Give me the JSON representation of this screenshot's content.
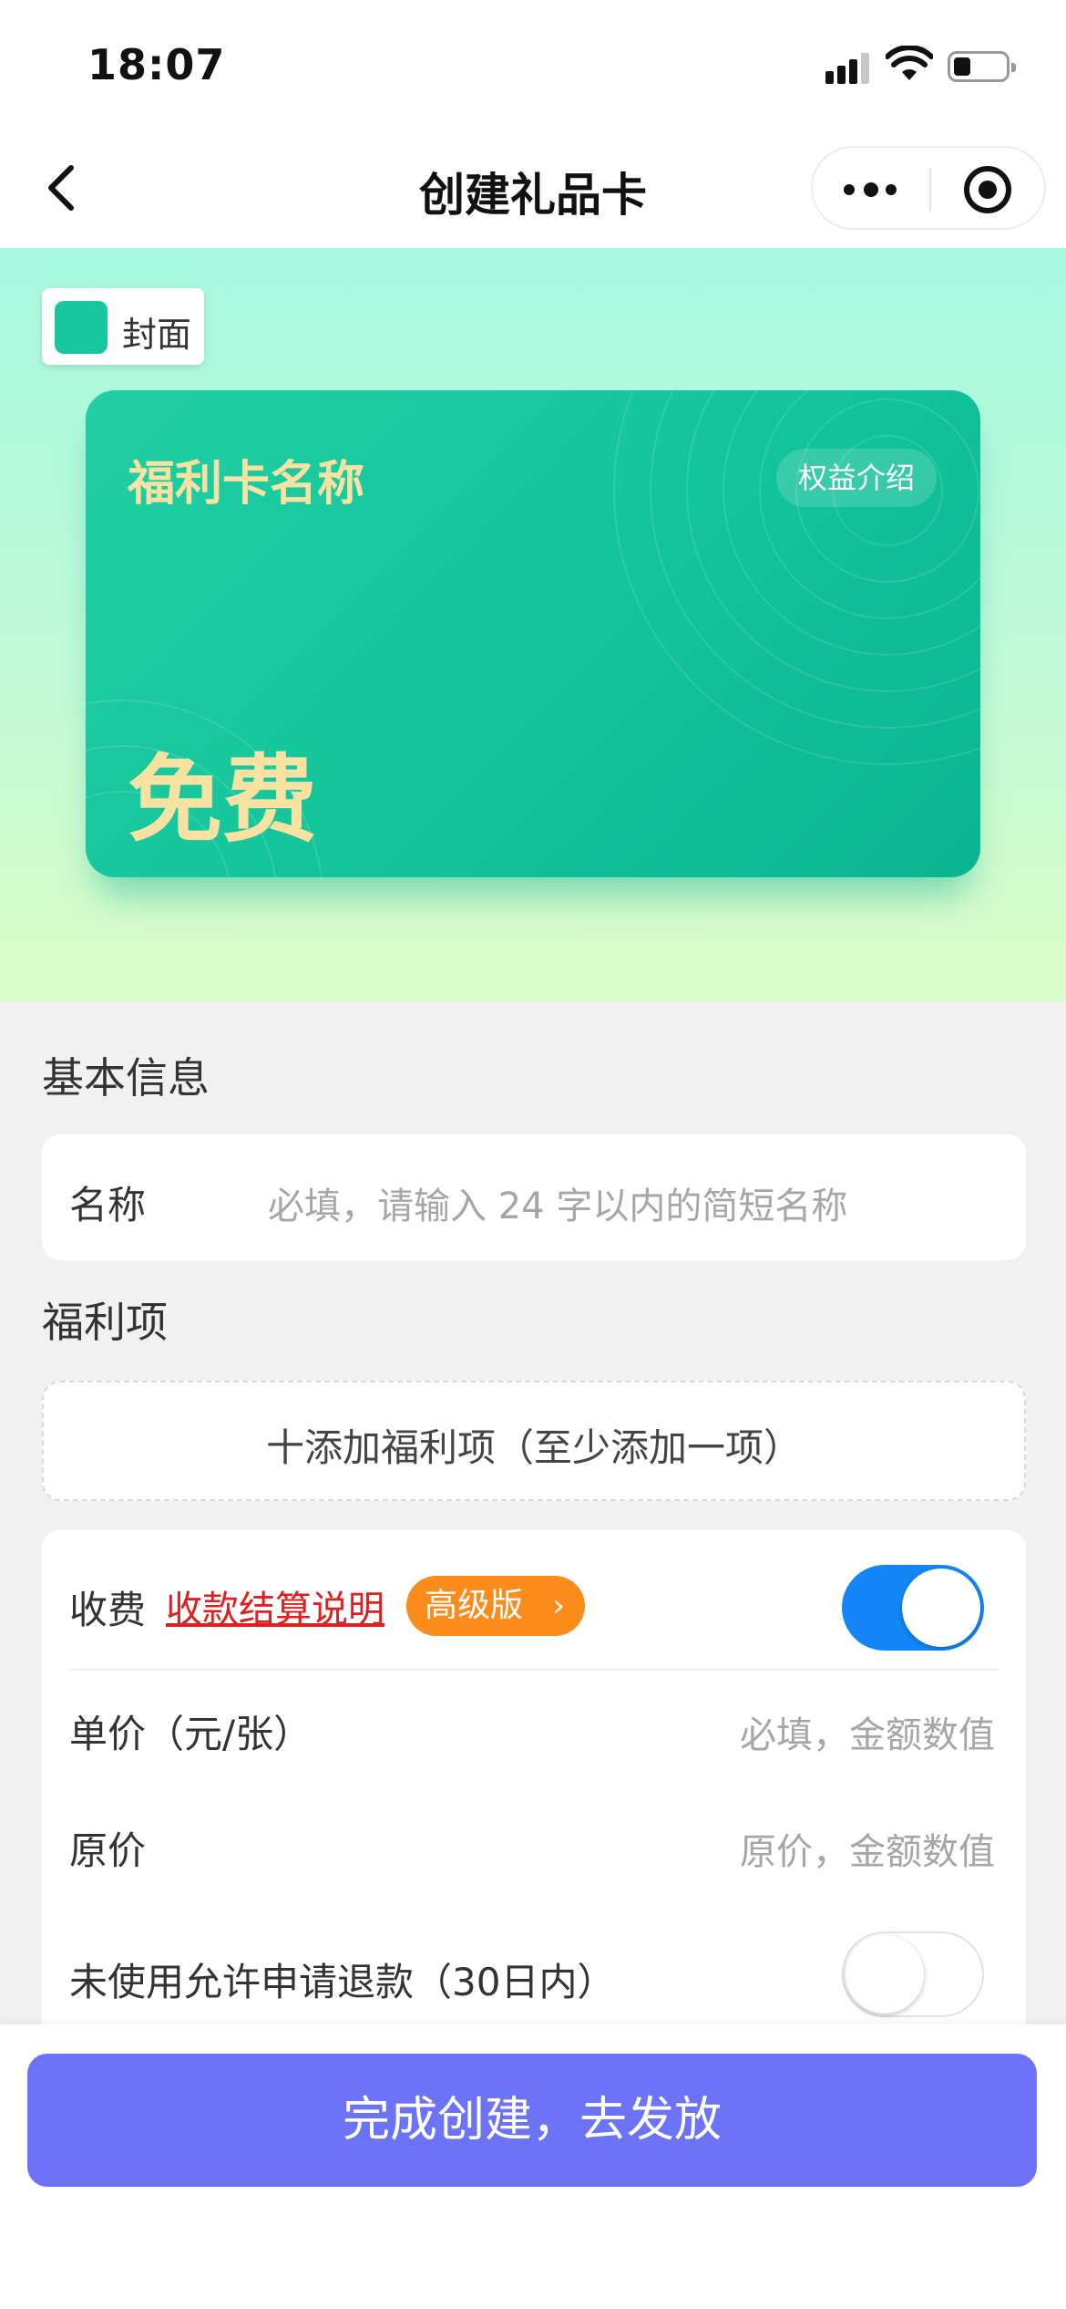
{
  "status_bar": {
    "time": "18:07"
  },
  "nav": {
    "title": "创建礼品卡"
  },
  "cover": {
    "label": "封面",
    "swatch_color": "#16c79f"
  },
  "card": {
    "name": "福利卡名称",
    "benefit_button": "权益介绍",
    "price": "免费",
    "gradient": [
      "#22cfa3",
      "#0ab692"
    ],
    "text_color": "#f7e2a2"
  },
  "basic_info": {
    "section_title": "基本信息",
    "name_label": "名称",
    "name_placeholder": "必填，请输入 24 字以内的简短名称"
  },
  "benefits": {
    "section_title": "福利项",
    "add_label": "十添加福利项（至少添加一项）"
  },
  "fees": {
    "charge_label": "收费",
    "settlement_link": "收款结算说明",
    "pro_badge": "高级版",
    "charge_enabled": true,
    "unit_price_label": "单价（元/张）",
    "unit_price_placeholder": "必填，金额数值",
    "original_price_label": "原价",
    "original_price_placeholder": "原价，金额数值",
    "refund_label": "未使用允许申请退款（30日内）",
    "refund_enabled": false
  },
  "footer": {
    "submit_label": "完成创建，去发放",
    "button_color": "#6c73f7"
  }
}
